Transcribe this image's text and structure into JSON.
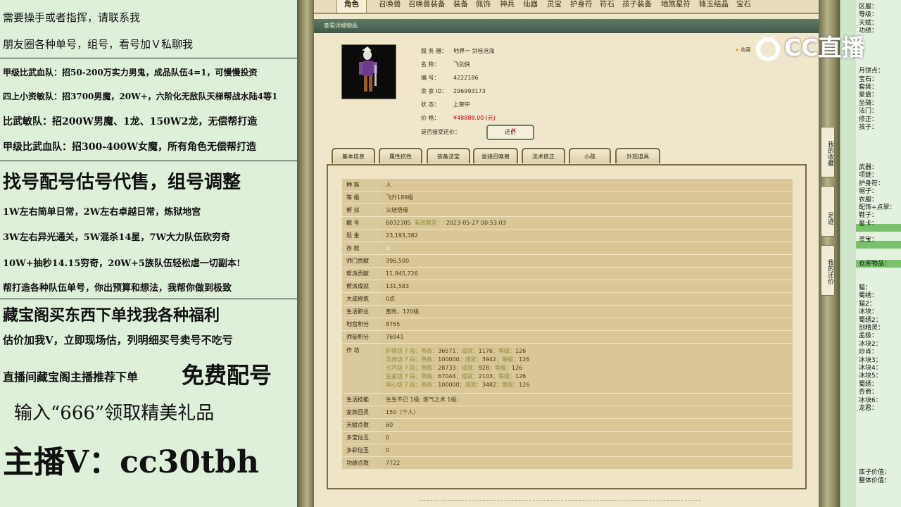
{
  "stream_overlay": {
    "lines": [
      "需要操手或者指挥，请联系我",
      "朋友圈各种单号，组号，看号加Ｖ私聊我",
      "甲级比武血队：招50-200万实力男鬼，成品队伍4=1，可慢慢投资",
      "四上小资敏队：招3700男魔，20W+，六阶化无敌队天梯帮战水陆4等1",
      "比武敏队：招200W男魔、1龙、150W2龙，无偿帮打造",
      "甲级比武血队：招300-400W女魔，所有角色无偿帮打造",
      "找号配号估号代售，组号调整",
      "1W左右简单日常，2W左右卓越日常，炼狱地宫",
      "3W左右异光通关，5W混杀14星，7W大力队伍砍穷奇",
      "10W+抽秒14.15穷奇，20W+5族队伍轻松虐一切副本!",
      "帮打造各种队伍单号，你出预算和想法，我帮你做到极致",
      "藏宝阁买东西下单找我各种福利",
      "估价加我V，立即现场估，列明细买号卖号不吃亏",
      "直播间藏宝阁主播推荐下单",
      "免费配号",
      "输入“666”领取精美礼品",
      "主播V：cc30tbh"
    ]
  },
  "top_tabs": [
    "角色",
    "召唤兽",
    "召唤兽装备",
    "装备",
    "佩饰",
    "神兵",
    "仙器",
    "灵宝",
    "护身符",
    "符石",
    "孩子装备",
    "地煞星符",
    "锋玉结晶",
    "宝石"
  ],
  "detail_title": "查看详细物品",
  "favorite_label": "收藏",
  "item_info": {
    "server_label": "服 务 器：",
    "server": "地界一 剑桂沧海",
    "name_label": "名        称：",
    "name": "飞剑侠",
    "id_label": "编        号：",
    "id": "4222186",
    "seller_label": "卖  家  ID：",
    "seller_id": "296993173",
    "status_label": "状        态：",
    "status": "上架中",
    "price_label": "价        格：",
    "price": "¥48888.00 (元)",
    "bargain_label": "是否接受还价：",
    "bargain_button": "还价"
  },
  "sub_tabs": [
    "基本信息",
    "属性抗性",
    "装备法宝",
    "坐骑召唤兽",
    "法术修正",
    "小孩",
    "外观道具"
  ],
  "attributes": [
    {
      "k": "种  族",
      "v": "人"
    },
    {
      "k": "等  级",
      "v": "飞升189级"
    },
    {
      "k": "帮  派",
      "v": "义结悟缘"
    },
    {
      "k": "靓  号",
      "v": "6032305",
      "extra_label": "有效期至：",
      "extra": "2023-05-27 00:53:03"
    },
    {
      "k": "现  金",
      "v": "23,193,382"
    },
    {
      "k": "存  款",
      "v": "0"
    },
    {
      "k": "师门贡献",
      "v": "396,500"
    },
    {
      "k": "帮派贡献",
      "v": "11,945,726"
    },
    {
      "k": "帮派成就",
      "v": "131,583"
    },
    {
      "k": "大成修炼",
      "v": "0点"
    },
    {
      "k": "生活职业",
      "v": "畜牧，120级"
    },
    {
      "k": "地宫积分",
      "v": "8765"
    },
    {
      "k": "师徒积分",
      "v": "76941"
    }
  ],
  "workshop": {
    "k": "作  坊",
    "lines": [
      {
        "name": "炉鼎坊 7 段；熟练：",
        "exp": "36571",
        "ach_l": "；成就：",
        "ach": "1176",
        "lv_l": "；等级：",
        "lv": "126"
      },
      {
        "name": "灵虎坊 7 段；熟练：",
        "exp": "100000",
        "ach_l": "；成就：",
        "ach": "3942",
        "lv_l": "；等级：",
        "lv": "126"
      },
      {
        "name": "七巧坊 7 段；熟练：",
        "exp": "28733",
        "ach_l": "；成就：",
        "ach": "928",
        "lv_l": "；等级：",
        "lv": "126"
      },
      {
        "name": "生家坊 7 段；熟练：",
        "exp": "67044",
        "ach_l": "；成就：",
        "ach": "2103",
        "lv_l": "；等级：",
        "lv": "126"
      },
      {
        "name": "同心坊 7 段；熟练：",
        "exp": "100000",
        "ach_l": "；成就：",
        "ach": "3482",
        "lv_l": "；等级：",
        "lv": "126"
      }
    ]
  },
  "attributes2": [
    {
      "k": "生活技能",
      "v": "生生不已 1级; 炼气之术 1级;"
    },
    {
      "k": "家族回灵",
      "v": "150（个人）"
    },
    {
      "k": "天赋点数",
      "v": "60"
    },
    {
      "k": "多宝仙玉",
      "v": "0"
    },
    {
      "k": "多彩仙玉",
      "v": "0"
    },
    {
      "k": "功绩点数",
      "v": "7722"
    }
  ],
  "side_tabs": [
    "我的收藏",
    "足迹",
    "我的还价"
  ],
  "right_list": [
    "区服：",
    "等级：",
    "天赋：",
    "功绩：",
    "",
    "",
    "",
    "",
    "月饼点：",
    "宝石：",
    "套装：",
    "星盘：",
    "坐骑：",
    "法门：",
    "修正：",
    "孩子：",
    "",
    "",
    "",
    "",
    "武器：",
    "项链：",
    "护身符：",
    "帽子：",
    "衣服：",
    "配饰+点翠：",
    "鞋子：",
    "星卡：",
    "",
    "灵宝：",
    "",
    "",
    "仓库物品：",
    "",
    "",
    "猫：",
    "蜀绣：",
    "猫2：",
    "冰块：",
    "蜀绣2：",
    "剑精灵：",
    "孟极：",
    "冰块2：",
    "炒肖：",
    "冰块3：",
    "冰块4：",
    "冰块5：",
    "蜀绣：",
    "杏商：",
    "冰块6：",
    "龙君：",
    "",
    "",
    "",
    "",
    "",
    "",
    "",
    "底子价值：",
    "整体价值："
  ],
  "logo_text": "CC直播"
}
